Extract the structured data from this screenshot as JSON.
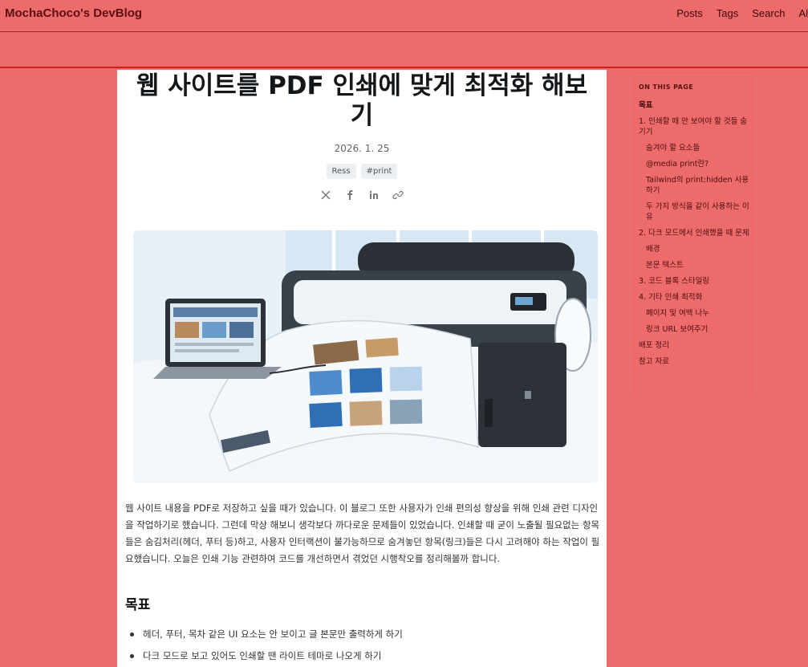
{
  "header": {
    "brand": "MochaChoco's DevBlog",
    "nav": [
      "Posts",
      "Tags",
      "Search",
      "Al"
    ]
  },
  "article": {
    "title": "웹 사이트를 PDF 인쇄에 맞게 최적화 해보기",
    "date": "2026. 1. 25",
    "tags": [
      "Ress",
      "#print"
    ],
    "share_icons": [
      "x-icon",
      "facebook-icon",
      "linkedin-icon",
      "link-icon"
    ],
    "hero_alt": "printer-illustration",
    "paragraph": "웹 사이트 내용을 PDF로 저장하고 싶을 때가 있습니다. 이 블로그 또한 사용자가 인쇄 편의성 향상을 위해 인쇄 관련 디자인을 작업하기로 했습니다. 그런데 막상 해보니 생각보다 까다로운 문제들이 있었습니다. 인쇄할 때 굳이 노출될 필요없는 항목들은 숨김처리(헤더, 푸터 등)하고, 사용자 인터랙션이 불가능하므로 숨겨놓던 항목(링크)들은 다시 고려해야 하는 작업이 필요했습니다. 오늘은 인쇄 기능 관련하여 코드를 개선하면서 겪었던 시행착오를 정리해볼까 합니다.",
    "section_heading": "목표",
    "bullets": [
      "헤더, 푸터, 목차 같은 UI 요소는 안 보이고 글 본문만 출력하게 하기",
      "다크 모드로 보고 있어도 인쇄할 땐 라이트 테마로 나오게 하기"
    ]
  },
  "toc": {
    "heading": "ON THIS PAGE",
    "items": [
      {
        "label": "목표",
        "level": 1,
        "active": true
      },
      {
        "label": "1. 인쇄할 때 안 보여야 할 것들 숨기기",
        "level": 1
      },
      {
        "label": "숨겨야 할 요소들",
        "level": 2
      },
      {
        "label": "@media print란?",
        "level": 2
      },
      {
        "label": "Tailwind의 print:hidden 사용하기",
        "level": 2
      },
      {
        "label": "두 가지 방식을 같이 사용하는 이유",
        "level": 2
      },
      {
        "label": "2. 다크 모드에서 인쇄했을 때 문제",
        "level": 1
      },
      {
        "label": "배경",
        "level": 2
      },
      {
        "label": "본문 텍스트",
        "level": 2
      },
      {
        "label": "3. 코드 블록 스타일링",
        "level": 1
      },
      {
        "label": "4. 기타 인쇄 최적화",
        "level": 1
      },
      {
        "label": "페이지 및 여백 나누",
        "level": 2
      },
      {
        "label": "링크 URL 보여주기",
        "level": 2
      },
      {
        "label": "배포 정리",
        "level": 1
      },
      {
        "label": "참고 자료",
        "level": 1
      }
    ]
  },
  "colors": {
    "page_bg": "#ee6b6b",
    "article_bg": "#ffffff",
    "accent_line": "#c42222"
  }
}
